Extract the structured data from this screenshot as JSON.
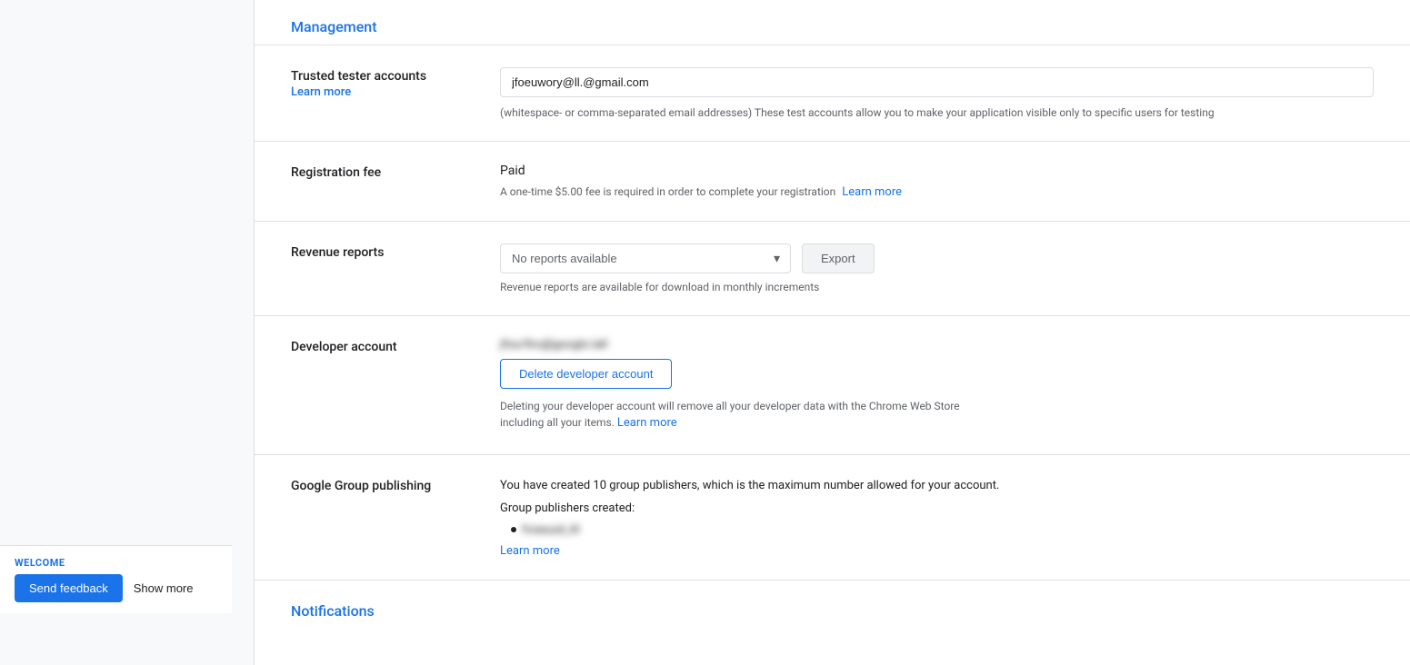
{
  "page": {
    "management_section_title": "Management",
    "notifications_section_title": "Notifications"
  },
  "trusted_tester": {
    "label": "Trusted tester accounts",
    "learn_more": "Learn more",
    "placeholder_email": "jfoeuwory@ll.@gmail.com",
    "helper_text": "(whitespace- or comma-separated email addresses) These test accounts allow you to make your application visible only to specific users for testing"
  },
  "registration_fee": {
    "label": "Registration fee",
    "status": "Paid",
    "description": "A one-time $5.00 fee is required in order to complete your registration",
    "learn_more": "Learn more"
  },
  "revenue_reports": {
    "label": "Revenue reports",
    "dropdown_value": "No reports available",
    "export_button": "Export",
    "helper_text": "Revenue reports are available for download in monthly increments",
    "dropdown_options": [
      "No reports available"
    ]
  },
  "developer_account": {
    "label": "Developer account",
    "account_blurred": "jfou/ltru@googlo.lall",
    "delete_button": "Delete developer account",
    "description_1": "Deleting your developer account will remove all your developer data with the Chrome Web",
    "description_2": "Store including all your items.",
    "learn_more": "Learn more"
  },
  "google_group_publishing": {
    "label": "Google Group publishing",
    "description": "You have created 10 group publishers, which is the maximum number allowed for your account.",
    "publishers_label": "Group publishers created:",
    "publisher_item": "fvoeuod_tll",
    "learn_more": "Learn more"
  },
  "bottom_bar": {
    "welcome_label": "WELCOME",
    "send_feedback": "Send feedback",
    "show_more": "Show more"
  }
}
